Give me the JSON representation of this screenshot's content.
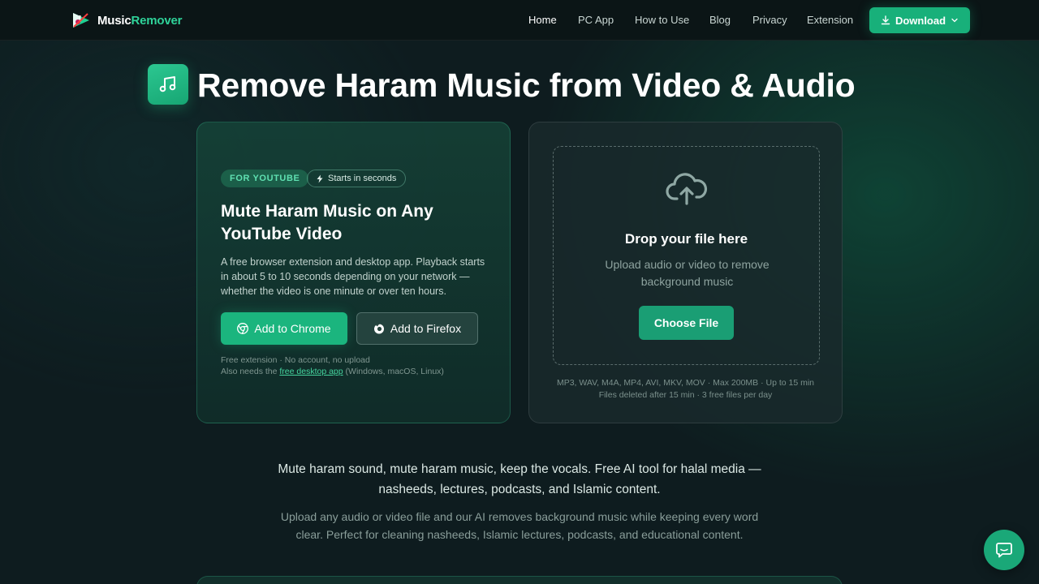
{
  "nav": {
    "brand_part1": "Music",
    "brand_part2": "Remover",
    "links": [
      {
        "label": "Home",
        "active": true
      },
      {
        "label": "PC App"
      },
      {
        "label": "How to Use"
      },
      {
        "label": "Blog"
      },
      {
        "label": "Privacy"
      },
      {
        "label": "Extension"
      }
    ],
    "download_label": "Download",
    "download_icon": "download-icon",
    "download_caret": "chevron-down-icon"
  },
  "hero": {
    "icon": "music-note-icon",
    "title": "Remove Haram Music from Video & Audio"
  },
  "youtube_card": {
    "badge": "FOR YOUTUBE",
    "speed_badge": "Starts in seconds",
    "speed_icon": "lightning-icon",
    "title": "Mute Haram Music on Any YouTube Video",
    "description": "A free browser extension and desktop app. Playback starts in about 5 to 10 seconds depending on your network — whether the video is one minute or over ten hours.",
    "chrome_button": "Add to Chrome",
    "firefox_button": "Add to Firefox",
    "fine_print_1": "Free extension · No account, no upload",
    "fine_print_2_before": "Also needs the ",
    "fine_print_2_link": "free desktop app",
    "fine_print_2_after": " (Windows, macOS, Linux)"
  },
  "upload_card": {
    "icon": "cloud-upload-icon",
    "title": "Drop your file here",
    "subtitle": "Upload audio or video to remove background music",
    "button": "Choose File",
    "limits_1": "MP3, WAV, M4A, MP4, AVI, MKV, MOV · Max 200MB · Up to 15 min",
    "limits_2": "Files deleted after 15 min · 3 free files per day"
  },
  "tagline": "Mute haram sound, mute haram music, keep the vocals. Free AI tool for halal media — nasheeds, lectures, podcasts, and Islamic content.",
  "subtext": "Upload any audio or video file and our AI removes background music while keeping every word clear. Perfect for cleaning nasheeds, Islamic lectures, podcasts, and educational content.",
  "chat": {
    "icon": "chat-bubble-icon"
  },
  "colors": {
    "accent": "#18b07a",
    "accent_text": "#2fd39a",
    "background": "#0e1c1f"
  }
}
